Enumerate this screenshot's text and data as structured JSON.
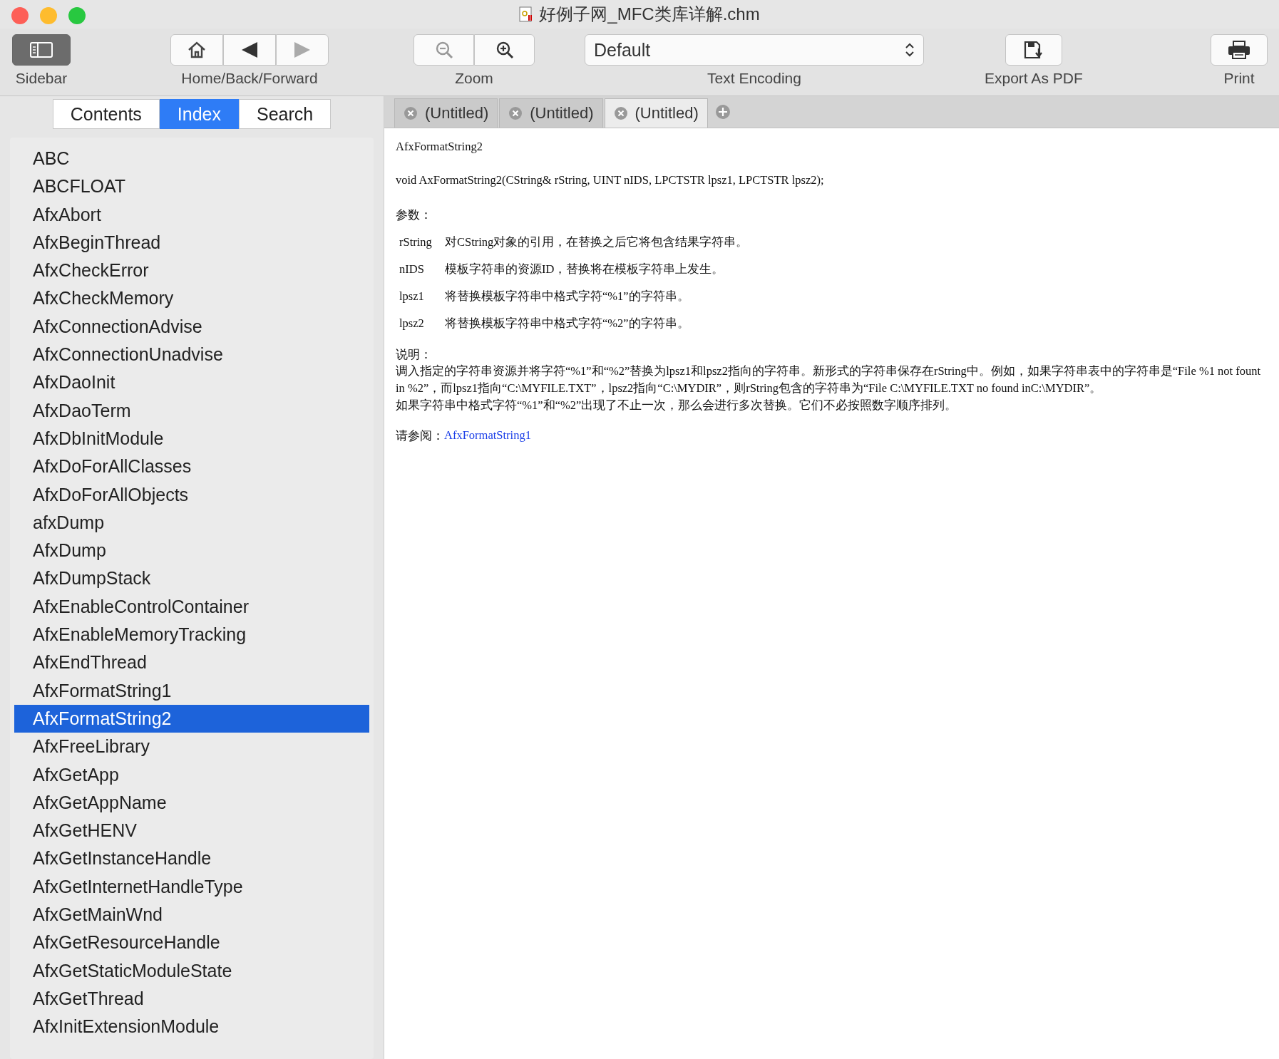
{
  "window": {
    "title": "好例子网_MFC类库详解.chm"
  },
  "toolbar": {
    "sidebar": {
      "label": "Sidebar",
      "on": true
    },
    "navigation": {
      "label": "Home/Back/Forward",
      "buttons": [
        {
          "kind": "home",
          "disabled": false
        },
        {
          "kind": "back",
          "disabled": false
        },
        {
          "kind": "forward",
          "disabled": true
        }
      ]
    },
    "zoom": {
      "label": "Zoom",
      "buttons": [
        {
          "kind": "zoom-out",
          "disabled": true
        },
        {
          "kind": "zoom-in",
          "disabled": false
        }
      ]
    },
    "text_encoding": {
      "label": "Text Encoding",
      "value": "Default"
    },
    "export": {
      "label": "Export As PDF"
    },
    "print": {
      "label": "Print"
    }
  },
  "sidebar": {
    "tabs": [
      {
        "label": "Contents",
        "selected": false
      },
      {
        "label": "Index",
        "selected": true
      },
      {
        "label": "Search",
        "selected": false
      }
    ],
    "items": [
      {
        "label": "ABC",
        "selected": false
      },
      {
        "label": "ABCFLOAT",
        "selected": false
      },
      {
        "label": "AfxAbort",
        "selected": false
      },
      {
        "label": "AfxBeginThread",
        "selected": false
      },
      {
        "label": "AfxCheckError",
        "selected": false
      },
      {
        "label": "AfxCheckMemory",
        "selected": false
      },
      {
        "label": "AfxConnectionAdvise",
        "selected": false
      },
      {
        "label": "AfxConnectionUnadvise",
        "selected": false
      },
      {
        "label": "AfxDaoInit",
        "selected": false
      },
      {
        "label": "AfxDaoTerm",
        "selected": false
      },
      {
        "label": "AfxDbInitModule",
        "selected": false
      },
      {
        "label": "AfxDoForAllClasses",
        "selected": false
      },
      {
        "label": "AfxDoForAllObjects",
        "selected": false
      },
      {
        "label": "afxDump",
        "selected": false
      },
      {
        "label": "AfxDump",
        "selected": false
      },
      {
        "label": "AfxDumpStack",
        "selected": false
      },
      {
        "label": "AfxEnableControlContainer",
        "selected": false
      },
      {
        "label": "AfxEnableMemoryTracking",
        "selected": false
      },
      {
        "label": "AfxEndThread",
        "selected": false
      },
      {
        "label": "AfxFormatString1",
        "selected": false
      },
      {
        "label": "AfxFormatString2",
        "selected": true
      },
      {
        "label": "AfxFreeLibrary",
        "selected": false
      },
      {
        "label": "AfxGetApp",
        "selected": false
      },
      {
        "label": "AfxGetAppName",
        "selected": false
      },
      {
        "label": "AfxGetHENV",
        "selected": false
      },
      {
        "label": "AfxGetInstanceHandle",
        "selected": false
      },
      {
        "label": "AfxGetInternetHandleType",
        "selected": false
      },
      {
        "label": "AfxGetMainWnd",
        "selected": false
      },
      {
        "label": "AfxGetResourceHandle",
        "selected": false
      },
      {
        "label": "AfxGetStaticModuleState",
        "selected": false
      },
      {
        "label": "AfxGetThread",
        "selected": false
      },
      {
        "label": "AfxInitExtensionModule",
        "selected": false
      }
    ]
  },
  "document_tabs": [
    {
      "label": "(Untitled)",
      "selected": false
    },
    {
      "label": "(Untitled)",
      "selected": false
    },
    {
      "label": "(Untitled)",
      "selected": true
    }
  ],
  "content": {
    "heading": "AfxFormatString2",
    "signature": "void AxFormatString2(CString& rString, UINT nIDS, LPCTSTR lpsz1, LPCTSTR lpsz2);",
    "params_title": "参数：",
    "params": [
      {
        "name": "rString",
        "description": "对CString对象的引用，在替换之后它将包含结果字符串。"
      },
      {
        "name": "nIDS",
        "description": "模板字符串的资源ID，替换将在模板字符串上发生。"
      },
      {
        "name": "lpsz1",
        "description": "将替换模板字符串中格式字符“%1”的字符串。"
      },
      {
        "name": "lpsz2",
        "description": "将替换模板字符串中格式字符“%2”的字符串。"
      }
    ],
    "remarks_title": "说明：",
    "remarks": [
      "调入指定的字符串资源并将字符“%1”和“%2”替换为lpsz1和lpsz2指向的字符串。新形式的字符串保存在rString中。例如，如果字符串表中的字符串是“File %1 not fount in %2”，而lpsz1指向“C:\\MYFILE.TXT”，lpsz2指向“C:\\MYDIR”，则rString包含的字符串为“File C:\\MYFILE.TXT no found inC:\\MYDIR”。",
      "如果字符串中格式字符“%1”和“%2”出现了不止一次，那么会进行多次替换。它们不必按照数字顺序排列。"
    ],
    "see_also_label": "请参阅：",
    "see_also_link": "AfxFormatString1"
  }
}
